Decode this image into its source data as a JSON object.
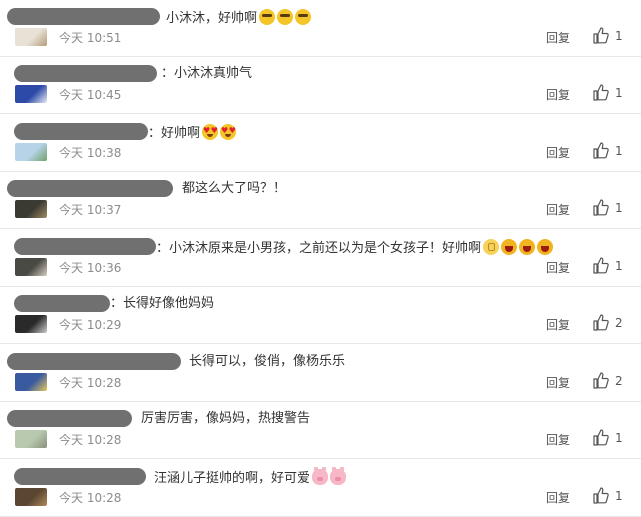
{
  "comments": [
    {
      "text": "小沐沐，好帅啊",
      "emojis": [
        "cool",
        "cool",
        "cool"
      ],
      "time": "今天 10:51",
      "reply": "回复",
      "likes": "1",
      "avatar_colors": [
        "#e8e2d6",
        "#b59b7a"
      ]
    },
    {
      "text": "：小沐沐真帅气",
      "emojis": [],
      "time": "今天 10:45",
      "reply": "回复",
      "likes": "1",
      "avatar_colors": [
        "#2d4aa8",
        "#e8ecf5"
      ]
    },
    {
      "text": "：好帅啊",
      "emojis": [
        "hearts",
        "hearts"
      ],
      "time": "今天 10:38",
      "reply": "回复",
      "likes": "1",
      "avatar_colors": [
        "#b7d3e8",
        "#6fa26b"
      ]
    },
    {
      "text": "都这么大了吗？！",
      "emojis": [],
      "time": "今天 10:37",
      "reply": "回复",
      "likes": "1",
      "avatar_colors": [
        "#3a3a32",
        "#a08c64"
      ]
    },
    {
      "text": "：小沐沐原来是小男孩，之前还以为是个女孩子！好帅啊",
      "emojis": [
        "ok",
        "laugh",
        "laugh",
        "laugh"
      ],
      "time": "今天 10:36",
      "reply": "回复",
      "likes": "1",
      "avatar_colors": [
        "#4a4a44",
        "#d8d0c0"
      ]
    },
    {
      "text": "：长得好像他妈妈",
      "emojis": [],
      "time": "今天 10:29",
      "reply": "回复",
      "likes": "2",
      "avatar_colors": [
        "#2a2a2a",
        "#cfcfcf"
      ]
    },
    {
      "text": "长得可以，俊俏，像杨乐乐",
      "emojis": [],
      "time": "今天 10:28",
      "reply": "回复",
      "likes": "2",
      "avatar_colors": [
        "#3a5aa0",
        "#e6c75a"
      ]
    },
    {
      "text": "厉害厉害，像妈妈，热搜警告",
      "emojis": [],
      "time": "今天 10:28",
      "reply": "回复",
      "likes": "1",
      "avatar_colors": [
        "#b8c9b0",
        "#8a8f7a"
      ]
    },
    {
      "text": "汪涵儿子挺帅的啊，好可爱",
      "emojis": [
        "pig",
        "pig"
      ],
      "time": "今天 10:28",
      "reply": "回复",
      "likes": "1",
      "avatar_colors": [
        "#5a4632",
        "#b08a5c"
      ]
    }
  ]
}
